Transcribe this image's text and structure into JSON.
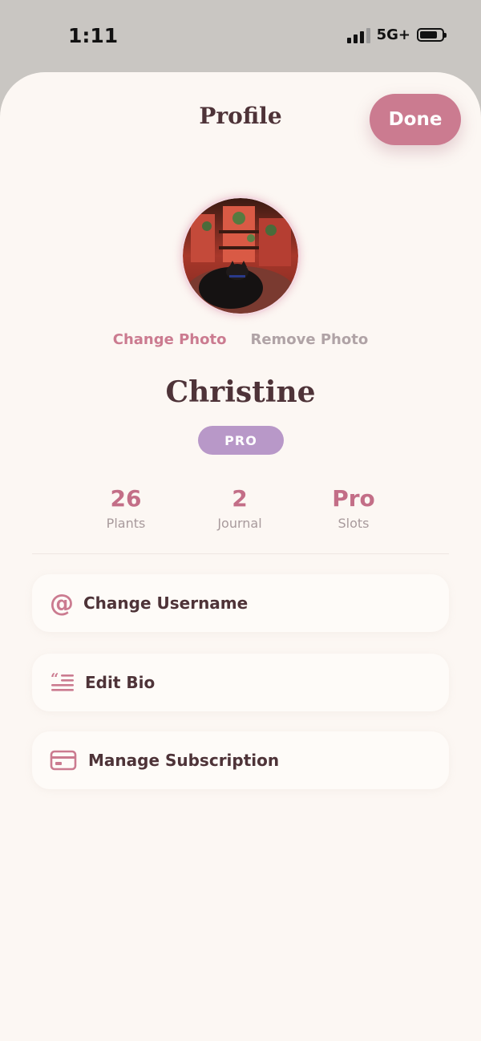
{
  "status_bar": {
    "time": "1:11",
    "network": "5G+",
    "battery_level": 0.8
  },
  "header": {
    "title": "Profile",
    "done_label": "Done"
  },
  "avatar": {
    "change_label": "Change Photo",
    "remove_label": "Remove Photo"
  },
  "user": {
    "name": "Christine",
    "badge": "PRO"
  },
  "stats": [
    {
      "value": "26",
      "label": "Plants"
    },
    {
      "value": "2",
      "label": "Journal"
    },
    {
      "value": "Pro",
      "label": "Slots"
    }
  ],
  "menu": [
    {
      "icon": "at-icon",
      "label": "Change Username"
    },
    {
      "icon": "quote-lines-icon",
      "label": "Edit Bio"
    },
    {
      "icon": "credit-card-icon",
      "label": "Manage Subscription"
    }
  ],
  "colors": {
    "accent": "#cb7b90",
    "badge": "#b898c8",
    "text_dark": "#4e3338",
    "muted": "#a89a9c",
    "sheet_bg": "#fcf7f3"
  }
}
